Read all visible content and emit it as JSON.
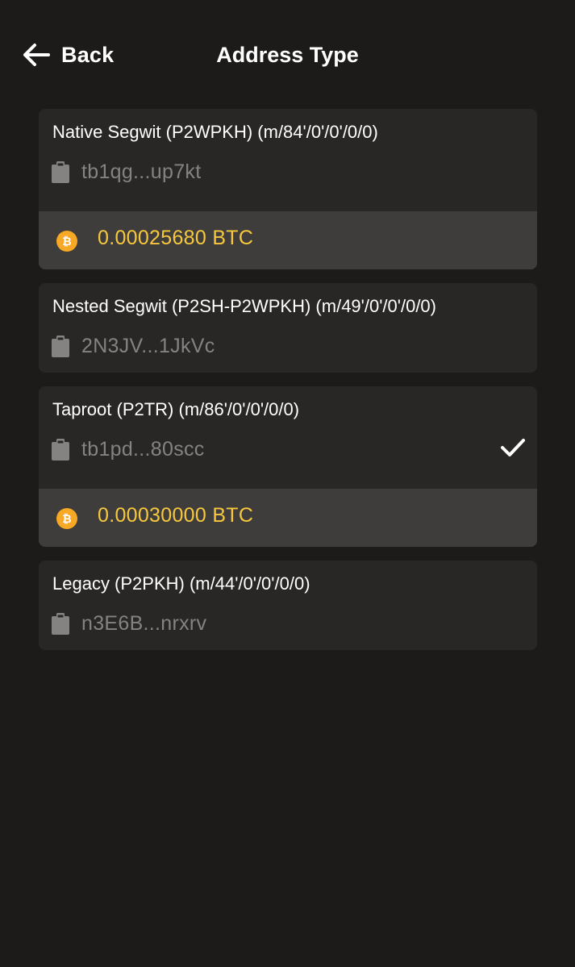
{
  "header": {
    "back_label": "Back",
    "title": "Address Type"
  },
  "addresses": [
    {
      "title": "Native Segwit (P2WPKH) (m/84'/0'/0'/0/0)",
      "address": "tb1qg...up7kt",
      "balance": "0.00025680 BTC",
      "selected": false
    },
    {
      "title": "Nested Segwit (P2SH-P2WPKH) (m/49'/0'/0'/0/0)",
      "address": "2N3JV...1JkVc",
      "selected": false
    },
    {
      "title": "Taproot (P2TR) (m/86'/0'/0'/0/0)",
      "address": "tb1pd...80scc",
      "balance": "0.00030000 BTC",
      "selected": true
    },
    {
      "title": "Legacy (P2PKH) (m/44'/0'/0'/0/0)",
      "address": "n3E6B...nrxrv",
      "selected": false
    }
  ],
  "icons": {
    "back": "arrow-left-icon",
    "clipboard": "clipboard-icon",
    "bitcoin": "bitcoin-icon",
    "check": "check-icon"
  },
  "colors": {
    "background": "#1c1b1a",
    "card": "#292726",
    "balance_row": "#3e3d3c",
    "address_text": "#858381",
    "balance_text": "#f8c83c",
    "bitcoin_coin": "#f7a824"
  }
}
